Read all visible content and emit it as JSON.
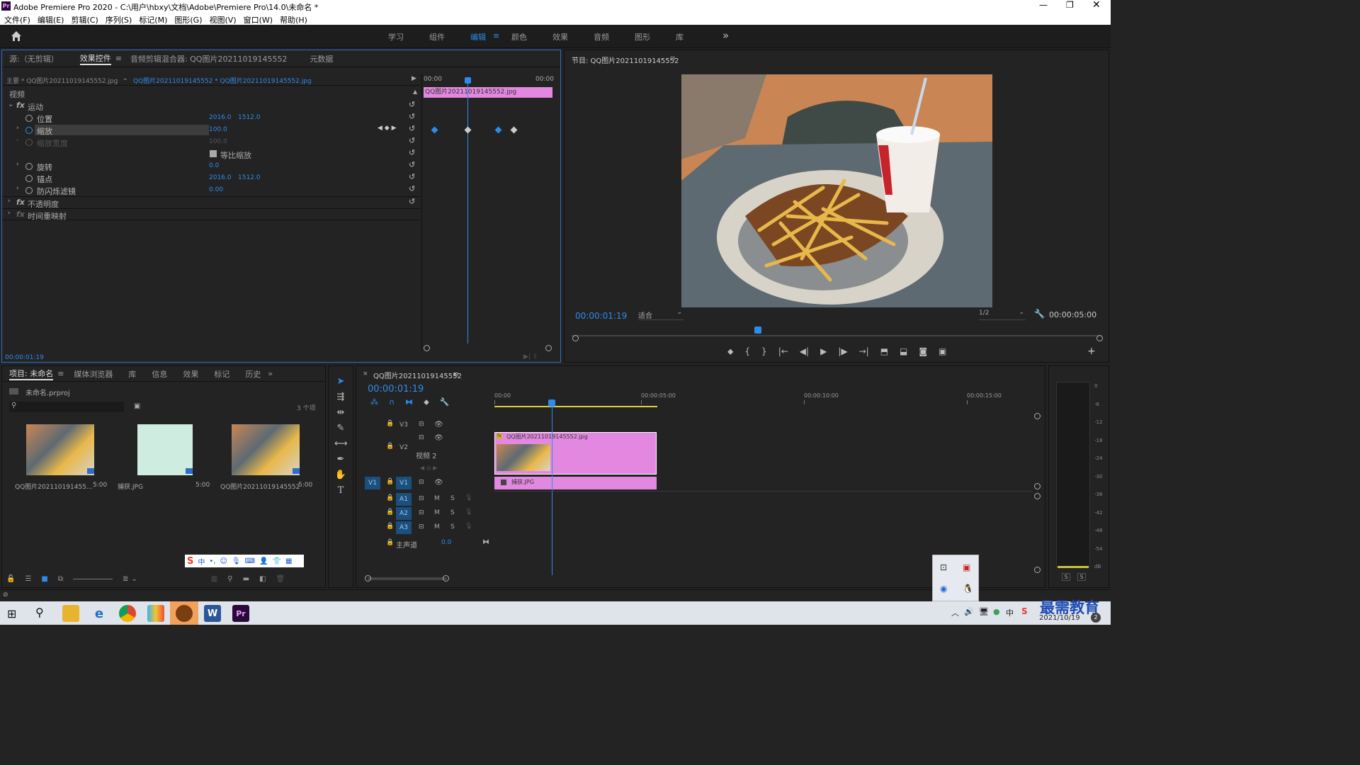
{
  "window": {
    "title": "Adobe Premiere Pro 2020 - C:\\用户\\hbxy\\文档\\Adobe\\Premiere Pro\\14.0\\未命名 *",
    "app_icon": "Pr"
  },
  "menu": [
    "文件(F)",
    "编辑(E)",
    "剪辑(C)",
    "序列(S)",
    "标记(M)",
    "图形(G)",
    "视图(V)",
    "窗口(W)",
    "帮助(H)"
  ],
  "workspaces": {
    "items": [
      "学习",
      "组件",
      "编辑",
      "颜色",
      "效果",
      "音频",
      "图形",
      "库"
    ],
    "active": "编辑",
    "more": "»"
  },
  "effect_panel": {
    "tabs": [
      "源:（无剪辑）",
      "效果控件",
      "音频剪辑混合器: QQ图片20211019145552",
      "元数据"
    ],
    "master_label": "主要 * QQ图片20211019145552.jpg",
    "clip_label": "QQ图片20211019145552 * QQ图片20211019145552.jpg",
    "time_start": "00:00",
    "time_end": "00:00",
    "clip_bar": "QQ图片20211019145552.jpg",
    "section": "视频",
    "motion": "运动",
    "props": [
      {
        "name": "位置",
        "v1": "2016.0",
        "v2": "1512.0"
      },
      {
        "name": "缩放",
        "v1": "100.0",
        "v2": ""
      },
      {
        "name": "缩放宽度",
        "v1": "100.0",
        "v2": ""
      },
      {
        "name": "等比缩放",
        "v1": "",
        "v2": ""
      },
      {
        "name": "旋转",
        "v1": "0.0",
        "v2": ""
      },
      {
        "name": "锚点",
        "v1": "2016.0",
        "v2": "1512.0"
      },
      {
        "name": "防闪烁滤镜",
        "v1": "0.00",
        "v2": ""
      }
    ],
    "opacity": "不透明度",
    "time_remap": "时间重映射",
    "timecode": "00:00:01:19"
  },
  "program": {
    "title": "节目: QQ图片20211019145552",
    "timecode": "00:00:01:19",
    "fit": "适合",
    "resolution": "1/2",
    "duration": "00:00:05:00",
    "image_colors": {
      "wall": "#c98654",
      "table": "#5e6a72",
      "fries": "#e8b84a"
    }
  },
  "project": {
    "tabs": [
      "项目: 未命名",
      "媒体浏览器",
      "库",
      "信息",
      "效果",
      "标记",
      "历史"
    ],
    "file": "未命名.prproj",
    "count": "3 个项",
    "items": [
      {
        "name": "QQ图片202110191455...",
        "dur": "5:00"
      },
      {
        "name": "捕获.JPG",
        "dur": "5:00"
      },
      {
        "name": "QQ图片20211019145552",
        "dur": "5:00"
      }
    ]
  },
  "timeline": {
    "title": "QQ图片20211019145552",
    "timecode": "00:00:01:19",
    "ruler": [
      "00:00",
      "00:00:05:00",
      "00:00:10:00",
      "00:00:15:00"
    ],
    "tracks": [
      {
        "id": "V3",
        "label": ""
      },
      {
        "id": "V2",
        "label": "视频 2"
      },
      {
        "id": "V1",
        "label": ""
      },
      {
        "id": "A1",
        "label": ""
      },
      {
        "id": "A2",
        "label": ""
      },
      {
        "id": "A3",
        "label": ""
      }
    ],
    "master": "主声道",
    "master_value": "0.0",
    "clip_v2": "QQ图片20211019145552.jpg",
    "clip_v1": "捕获.JPG",
    "clip_color": "#e388e0"
  },
  "meter": {
    "labels": [
      "0",
      "-6",
      "-12",
      "-18",
      "-24",
      "-30",
      "-36",
      "-42",
      "-48",
      "-54",
      "dB"
    ],
    "solo": [
      "S",
      "S"
    ]
  },
  "taskbar": {
    "date": "2021/10/19",
    "watermark": "最需教育",
    "badge": "2"
  }
}
